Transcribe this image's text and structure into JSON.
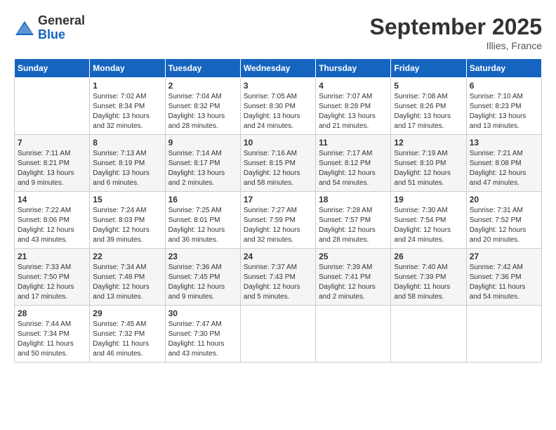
{
  "header": {
    "logo_general": "General",
    "logo_blue": "Blue",
    "month_title": "September 2025",
    "location": "Illies, France"
  },
  "days_of_week": [
    "Sunday",
    "Monday",
    "Tuesday",
    "Wednesday",
    "Thursday",
    "Friday",
    "Saturday"
  ],
  "weeks": [
    [
      {
        "num": "",
        "info": ""
      },
      {
        "num": "1",
        "info": "Sunrise: 7:02 AM\nSunset: 8:34 PM\nDaylight: 13 hours\nand 32 minutes."
      },
      {
        "num": "2",
        "info": "Sunrise: 7:04 AM\nSunset: 8:32 PM\nDaylight: 13 hours\nand 28 minutes."
      },
      {
        "num": "3",
        "info": "Sunrise: 7:05 AM\nSunset: 8:30 PM\nDaylight: 13 hours\nand 24 minutes."
      },
      {
        "num": "4",
        "info": "Sunrise: 7:07 AM\nSunset: 8:28 PM\nDaylight: 13 hours\nand 21 minutes."
      },
      {
        "num": "5",
        "info": "Sunrise: 7:08 AM\nSunset: 8:26 PM\nDaylight: 13 hours\nand 17 minutes."
      },
      {
        "num": "6",
        "info": "Sunrise: 7:10 AM\nSunset: 8:23 PM\nDaylight: 13 hours\nand 13 minutes."
      }
    ],
    [
      {
        "num": "7",
        "info": "Sunrise: 7:11 AM\nSunset: 8:21 PM\nDaylight: 13 hours\nand 9 minutes."
      },
      {
        "num": "8",
        "info": "Sunrise: 7:13 AM\nSunset: 8:19 PM\nDaylight: 13 hours\nand 6 minutes."
      },
      {
        "num": "9",
        "info": "Sunrise: 7:14 AM\nSunset: 8:17 PM\nDaylight: 13 hours\nand 2 minutes."
      },
      {
        "num": "10",
        "info": "Sunrise: 7:16 AM\nSunset: 8:15 PM\nDaylight: 12 hours\nand 58 minutes."
      },
      {
        "num": "11",
        "info": "Sunrise: 7:17 AM\nSunset: 8:12 PM\nDaylight: 12 hours\nand 54 minutes."
      },
      {
        "num": "12",
        "info": "Sunrise: 7:19 AM\nSunset: 8:10 PM\nDaylight: 12 hours\nand 51 minutes."
      },
      {
        "num": "13",
        "info": "Sunrise: 7:21 AM\nSunset: 8:08 PM\nDaylight: 12 hours\nand 47 minutes."
      }
    ],
    [
      {
        "num": "14",
        "info": "Sunrise: 7:22 AM\nSunset: 8:06 PM\nDaylight: 12 hours\nand 43 minutes."
      },
      {
        "num": "15",
        "info": "Sunrise: 7:24 AM\nSunset: 8:03 PM\nDaylight: 12 hours\nand 39 minutes."
      },
      {
        "num": "16",
        "info": "Sunrise: 7:25 AM\nSunset: 8:01 PM\nDaylight: 12 hours\nand 36 minutes."
      },
      {
        "num": "17",
        "info": "Sunrise: 7:27 AM\nSunset: 7:59 PM\nDaylight: 12 hours\nand 32 minutes."
      },
      {
        "num": "18",
        "info": "Sunrise: 7:28 AM\nSunset: 7:57 PM\nDaylight: 12 hours\nand 28 minutes."
      },
      {
        "num": "19",
        "info": "Sunrise: 7:30 AM\nSunset: 7:54 PM\nDaylight: 12 hours\nand 24 minutes."
      },
      {
        "num": "20",
        "info": "Sunrise: 7:31 AM\nSunset: 7:52 PM\nDaylight: 12 hours\nand 20 minutes."
      }
    ],
    [
      {
        "num": "21",
        "info": "Sunrise: 7:33 AM\nSunset: 7:50 PM\nDaylight: 12 hours\nand 17 minutes."
      },
      {
        "num": "22",
        "info": "Sunrise: 7:34 AM\nSunset: 7:48 PM\nDaylight: 12 hours\nand 13 minutes."
      },
      {
        "num": "23",
        "info": "Sunrise: 7:36 AM\nSunset: 7:45 PM\nDaylight: 12 hours\nand 9 minutes."
      },
      {
        "num": "24",
        "info": "Sunrise: 7:37 AM\nSunset: 7:43 PM\nDaylight: 12 hours\nand 5 minutes."
      },
      {
        "num": "25",
        "info": "Sunrise: 7:39 AM\nSunset: 7:41 PM\nDaylight: 12 hours\nand 2 minutes."
      },
      {
        "num": "26",
        "info": "Sunrise: 7:40 AM\nSunset: 7:39 PM\nDaylight: 11 hours\nand 58 minutes."
      },
      {
        "num": "27",
        "info": "Sunrise: 7:42 AM\nSunset: 7:36 PM\nDaylight: 11 hours\nand 54 minutes."
      }
    ],
    [
      {
        "num": "28",
        "info": "Sunrise: 7:44 AM\nSunset: 7:34 PM\nDaylight: 11 hours\nand 50 minutes."
      },
      {
        "num": "29",
        "info": "Sunrise: 7:45 AM\nSunset: 7:32 PM\nDaylight: 11 hours\nand 46 minutes."
      },
      {
        "num": "30",
        "info": "Sunrise: 7:47 AM\nSunset: 7:30 PM\nDaylight: 11 hours\nand 43 minutes."
      },
      {
        "num": "",
        "info": ""
      },
      {
        "num": "",
        "info": ""
      },
      {
        "num": "",
        "info": ""
      },
      {
        "num": "",
        "info": ""
      }
    ]
  ]
}
